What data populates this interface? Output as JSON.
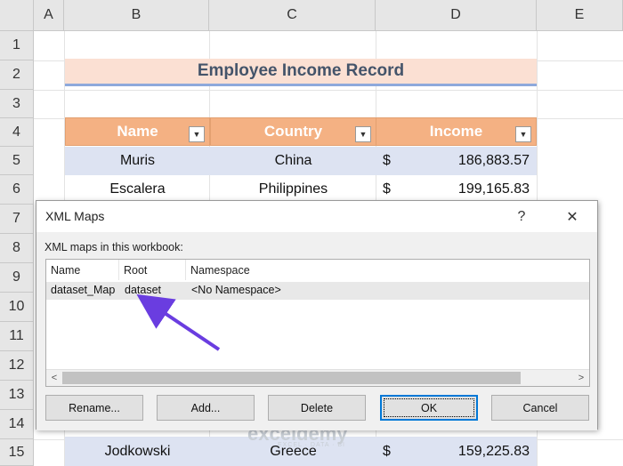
{
  "columns": [
    "A",
    "B",
    "C",
    "D",
    "E"
  ],
  "rows": [
    "1",
    "2",
    "3",
    "4",
    "5",
    "6",
    "7",
    "8",
    "9",
    "10",
    "11",
    "12",
    "13",
    "14",
    "15"
  ],
  "sheet": {
    "title": "Employee Income Record",
    "headers": {
      "name": "Name",
      "country": "Country",
      "income": "Income"
    },
    "records": [
      {
        "name": "Muris",
        "country": "China",
        "currency": "$",
        "income": "186,883.57"
      },
      {
        "name": "Escalera",
        "country": "Philippines",
        "currency": "$",
        "income": "199,165.83"
      },
      {
        "name": "Jodkowski",
        "country": "Greece",
        "currency": "$",
        "income": "159,225.83"
      }
    ]
  },
  "dialog": {
    "title": "XML Maps",
    "help": "?",
    "close": "✕",
    "list_label": "XML maps in this workbook:",
    "list_headers": {
      "name": "Name",
      "root": "Root",
      "namespace": "Namespace"
    },
    "maps": [
      {
        "name": "dataset_Map",
        "root": "dataset",
        "namespace": "<No Namespace>"
      }
    ],
    "scroll_left": "<",
    "scroll_right": ">",
    "buttons": {
      "rename": "Rename...",
      "add": "Add...",
      "delete": "Delete",
      "ok": "OK",
      "cancel": "Cancel"
    }
  },
  "watermark": {
    "brand": "exceldemy",
    "tagline": "EXCEL · DATA · BI"
  },
  "colors": {
    "header_fill": "#f4b183",
    "band_fill": "#dde3f2",
    "title_fill": "#fbe0d3",
    "arrow": "#6a3de0"
  }
}
